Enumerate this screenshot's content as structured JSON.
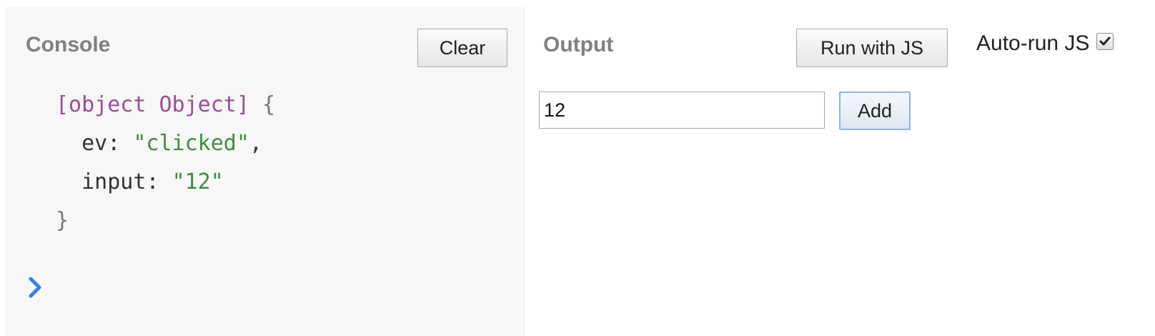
{
  "console": {
    "title": "Console",
    "clear_label": "Clear",
    "log": {
      "open_kw": "[object Object]",
      "open_brace": "{",
      "entries": [
        {
          "key": "ev",
          "value": "\"clicked\"",
          "sep": ","
        },
        {
          "key": "input",
          "value": "\"12\"",
          "sep": ""
        }
      ],
      "close_brace": "}"
    },
    "prompt_icon": "chevron-right-icon",
    "colors": {
      "prompt": "#3a7de8",
      "keyword": "#9b4c99",
      "string": "#3d8f3d"
    }
  },
  "output": {
    "title": "Output",
    "run_label": "Run with JS",
    "autorun_label": "Auto-run JS",
    "autorun_checked": true,
    "input_value": "12",
    "add_label": "Add"
  }
}
